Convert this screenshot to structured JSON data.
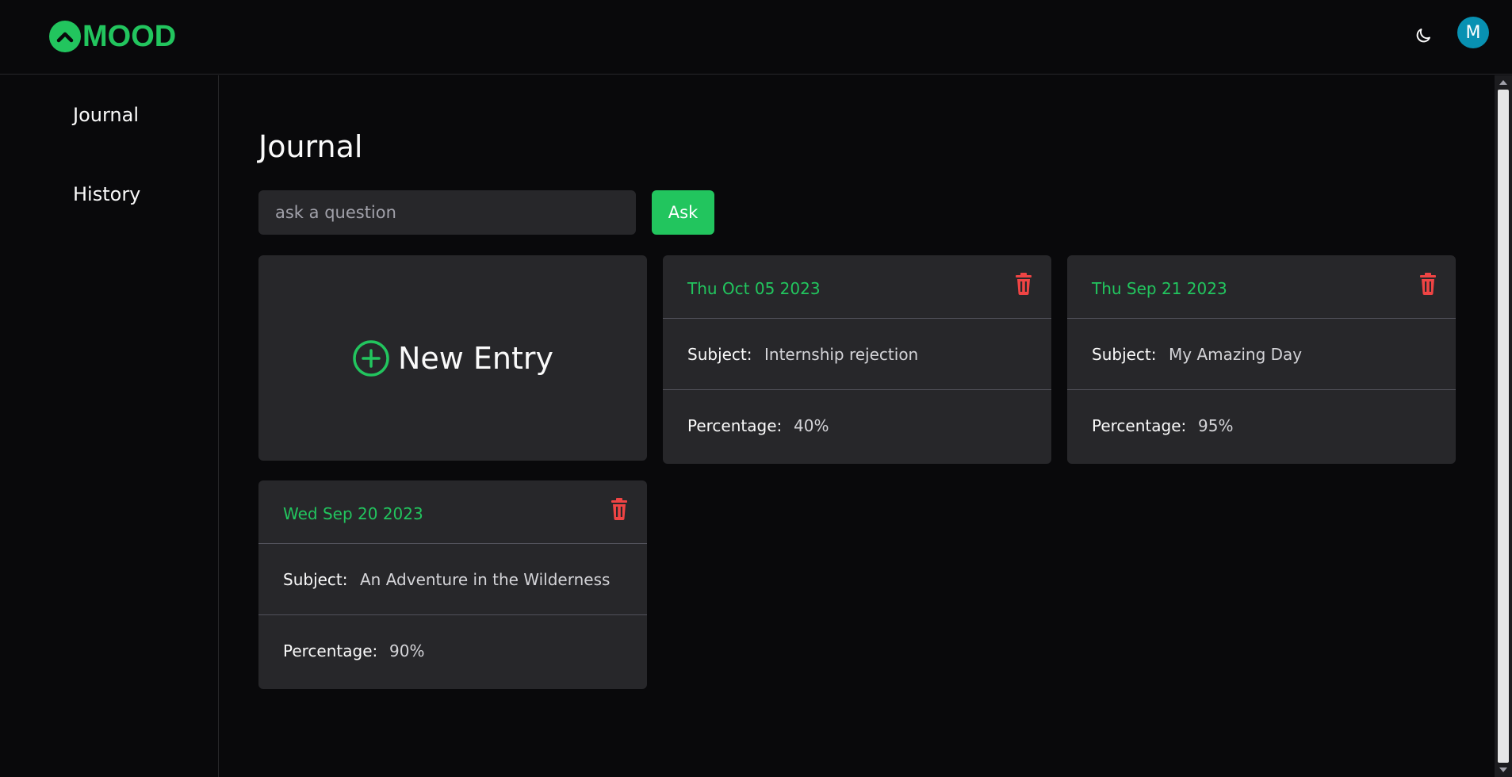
{
  "header": {
    "logo_text": "MOOD",
    "avatar_initial": "M",
    "theme_icon": "moon-icon",
    "colors": {
      "brand": "#22c55e",
      "avatar": "#0891b2",
      "background": "#09090b"
    }
  },
  "sidebar": {
    "items": [
      {
        "label": "Journal"
      },
      {
        "label": "History"
      }
    ]
  },
  "main": {
    "title": "Journal",
    "search": {
      "placeholder": "ask a question",
      "value": ""
    },
    "ask_label": "Ask",
    "new_entry_label": "New Entry",
    "subject_label": "Subject:",
    "percentage_label": "Percentage:",
    "entries": [
      {
        "date": "Thu Oct 05 2023",
        "subject": "Internship rejection",
        "percentage": "40%"
      },
      {
        "date": "Thu Sep 21 2023",
        "subject": "My Amazing Day",
        "percentage": "95%"
      },
      {
        "date": "Wed Sep 20 2023",
        "subject": "An Adventure in the Wilderness",
        "percentage": "90%"
      }
    ],
    "colors": {
      "date": "#22c55e",
      "delete": "#ef4444",
      "card": "#27272a"
    }
  }
}
